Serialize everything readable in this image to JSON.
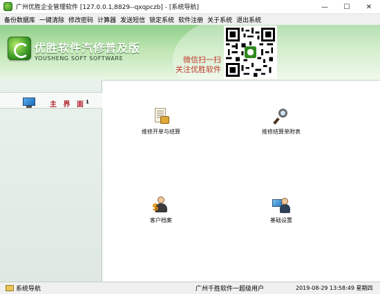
{
  "window": {
    "title": "广州优胜企业管理软件 [127.0.0.1,8829--qxqpczb] - [系统导航]",
    "controls": [
      "—",
      "☐",
      "✕"
    ]
  },
  "menu": [
    "备份数据库",
    "一键清除",
    "修改密码",
    "计算器",
    "发送短信",
    "锁定系统",
    "软件注册",
    "关于系统",
    "退出系统"
  ],
  "banner": {
    "title": "优胜软件汽修普及版",
    "subtitle": "YOUSHENG SOFT SOFTWARE",
    "scan_line1": "微信扫一扫",
    "scan_line2": "关注优胜软件"
  },
  "sidebar": {
    "main_label": "主 界 面",
    "main_superscript": "1"
  },
  "functions": {
    "repair_order": "维修开单与结算",
    "repair_list": "维修结算单附表",
    "customer_file": "客户档案",
    "basic_settings": "基础设置"
  },
  "statusbar": {
    "nav_label": "系统导航",
    "user": "广州千胜软件一超级用户",
    "datetime": "2019-08-29  13:58:49  星期四"
  },
  "icons": {
    "app": "app-logo-icon",
    "sidebar_main": "monitor-icon",
    "repair_order": "document-bag-icon",
    "repair_list": "magnifier-icon",
    "customer_file": "customer-dollar-icon",
    "basic_settings": "computer-user-icon",
    "status_nav": "folder-icon"
  },
  "colors": {
    "banner_green": "#8fcf8a",
    "scan_text": "#c0392b",
    "nav_label": "#b0202a"
  }
}
